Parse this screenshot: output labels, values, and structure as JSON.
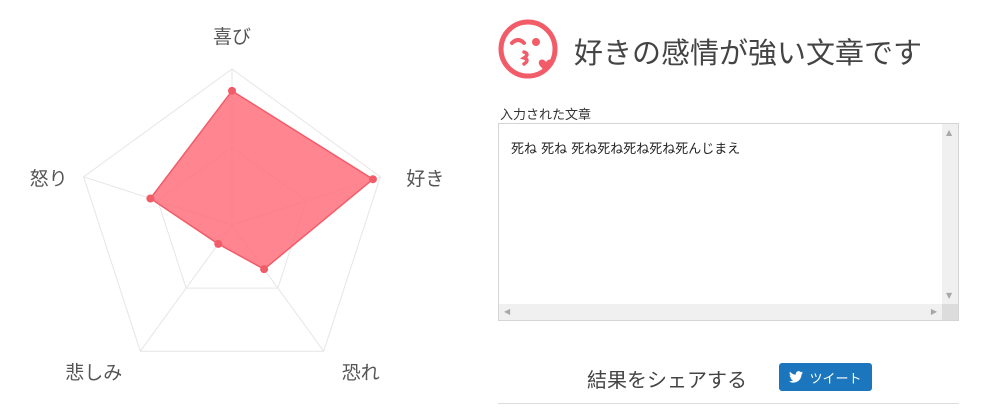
{
  "radar": {
    "axes": [
      "喜び",
      "好き",
      "恐れ",
      "悲しみ",
      "怒り"
    ],
    "values": [
      0.86,
      0.95,
      0.35,
      0.15,
      0.55
    ],
    "fill_color": "#ff6b77",
    "point_color": "#f25c68",
    "grid_color": "#e6e6e6"
  },
  "result": {
    "icon": "kissing-face-icon",
    "title": "好きの感情が強い文章です"
  },
  "input": {
    "label": "入力された文章",
    "text": "死ね 死ね 死ね死ね死ね死ね死んじまえ"
  },
  "share": {
    "label": "結果をシェアする",
    "tweet_label": "ツイート"
  },
  "colors": {
    "accent": "#f25c68",
    "twitter": "#1b76bd"
  }
}
